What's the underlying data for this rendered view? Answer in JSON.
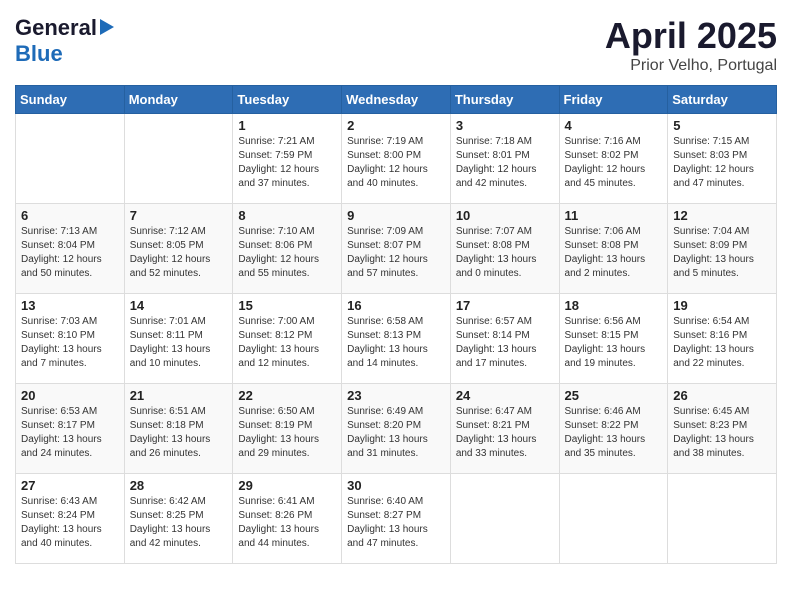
{
  "logo": {
    "general": "General",
    "blue": "Blue"
  },
  "title": {
    "month_year": "April 2025",
    "location": "Prior Velho, Portugal"
  },
  "weekdays": [
    "Sunday",
    "Monday",
    "Tuesday",
    "Wednesday",
    "Thursday",
    "Friday",
    "Saturday"
  ],
  "weeks": [
    [
      {
        "day": "",
        "info": ""
      },
      {
        "day": "",
        "info": ""
      },
      {
        "day": "1",
        "info": "Sunrise: 7:21 AM\nSunset: 7:59 PM\nDaylight: 12 hours and 37 minutes."
      },
      {
        "day": "2",
        "info": "Sunrise: 7:19 AM\nSunset: 8:00 PM\nDaylight: 12 hours and 40 minutes."
      },
      {
        "day": "3",
        "info": "Sunrise: 7:18 AM\nSunset: 8:01 PM\nDaylight: 12 hours and 42 minutes."
      },
      {
        "day": "4",
        "info": "Sunrise: 7:16 AM\nSunset: 8:02 PM\nDaylight: 12 hours and 45 minutes."
      },
      {
        "day": "5",
        "info": "Sunrise: 7:15 AM\nSunset: 8:03 PM\nDaylight: 12 hours and 47 minutes."
      }
    ],
    [
      {
        "day": "6",
        "info": "Sunrise: 7:13 AM\nSunset: 8:04 PM\nDaylight: 12 hours and 50 minutes."
      },
      {
        "day": "7",
        "info": "Sunrise: 7:12 AM\nSunset: 8:05 PM\nDaylight: 12 hours and 52 minutes."
      },
      {
        "day": "8",
        "info": "Sunrise: 7:10 AM\nSunset: 8:06 PM\nDaylight: 12 hours and 55 minutes."
      },
      {
        "day": "9",
        "info": "Sunrise: 7:09 AM\nSunset: 8:07 PM\nDaylight: 12 hours and 57 minutes."
      },
      {
        "day": "10",
        "info": "Sunrise: 7:07 AM\nSunset: 8:08 PM\nDaylight: 13 hours and 0 minutes."
      },
      {
        "day": "11",
        "info": "Sunrise: 7:06 AM\nSunset: 8:08 PM\nDaylight: 13 hours and 2 minutes."
      },
      {
        "day": "12",
        "info": "Sunrise: 7:04 AM\nSunset: 8:09 PM\nDaylight: 13 hours and 5 minutes."
      }
    ],
    [
      {
        "day": "13",
        "info": "Sunrise: 7:03 AM\nSunset: 8:10 PM\nDaylight: 13 hours and 7 minutes."
      },
      {
        "day": "14",
        "info": "Sunrise: 7:01 AM\nSunset: 8:11 PM\nDaylight: 13 hours and 10 minutes."
      },
      {
        "day": "15",
        "info": "Sunrise: 7:00 AM\nSunset: 8:12 PM\nDaylight: 13 hours and 12 minutes."
      },
      {
        "day": "16",
        "info": "Sunrise: 6:58 AM\nSunset: 8:13 PM\nDaylight: 13 hours and 14 minutes."
      },
      {
        "day": "17",
        "info": "Sunrise: 6:57 AM\nSunset: 8:14 PM\nDaylight: 13 hours and 17 minutes."
      },
      {
        "day": "18",
        "info": "Sunrise: 6:56 AM\nSunset: 8:15 PM\nDaylight: 13 hours and 19 minutes."
      },
      {
        "day": "19",
        "info": "Sunrise: 6:54 AM\nSunset: 8:16 PM\nDaylight: 13 hours and 22 minutes."
      }
    ],
    [
      {
        "day": "20",
        "info": "Sunrise: 6:53 AM\nSunset: 8:17 PM\nDaylight: 13 hours and 24 minutes."
      },
      {
        "day": "21",
        "info": "Sunrise: 6:51 AM\nSunset: 8:18 PM\nDaylight: 13 hours and 26 minutes."
      },
      {
        "day": "22",
        "info": "Sunrise: 6:50 AM\nSunset: 8:19 PM\nDaylight: 13 hours and 29 minutes."
      },
      {
        "day": "23",
        "info": "Sunrise: 6:49 AM\nSunset: 8:20 PM\nDaylight: 13 hours and 31 minutes."
      },
      {
        "day": "24",
        "info": "Sunrise: 6:47 AM\nSunset: 8:21 PM\nDaylight: 13 hours and 33 minutes."
      },
      {
        "day": "25",
        "info": "Sunrise: 6:46 AM\nSunset: 8:22 PM\nDaylight: 13 hours and 35 minutes."
      },
      {
        "day": "26",
        "info": "Sunrise: 6:45 AM\nSunset: 8:23 PM\nDaylight: 13 hours and 38 minutes."
      }
    ],
    [
      {
        "day": "27",
        "info": "Sunrise: 6:43 AM\nSunset: 8:24 PM\nDaylight: 13 hours and 40 minutes."
      },
      {
        "day": "28",
        "info": "Sunrise: 6:42 AM\nSunset: 8:25 PM\nDaylight: 13 hours and 42 minutes."
      },
      {
        "day": "29",
        "info": "Sunrise: 6:41 AM\nSunset: 8:26 PM\nDaylight: 13 hours and 44 minutes."
      },
      {
        "day": "30",
        "info": "Sunrise: 6:40 AM\nSunset: 8:27 PM\nDaylight: 13 hours and 47 minutes."
      },
      {
        "day": "",
        "info": ""
      },
      {
        "day": "",
        "info": ""
      },
      {
        "day": "",
        "info": ""
      }
    ]
  ]
}
